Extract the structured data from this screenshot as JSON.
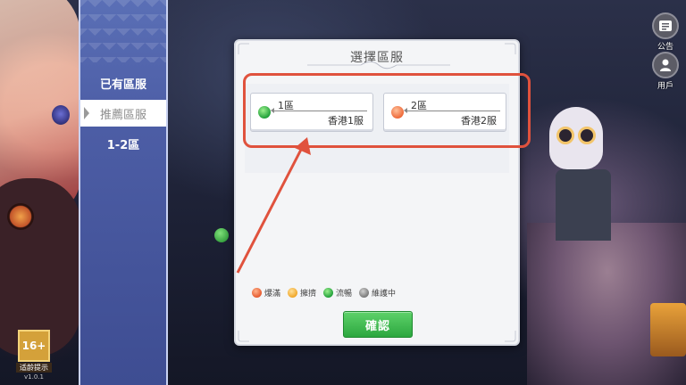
{
  "dialog": {
    "title": "選擇區服",
    "confirm_label": "確認",
    "servers": [
      {
        "zone": "1區",
        "name": "香港1服",
        "status_color": "#22a03a"
      },
      {
        "zone": "2區",
        "name": "香港2服",
        "status_color": "#ee6a3a"
      }
    ],
    "legend": [
      {
        "label": "爆滿",
        "icon": "status-full-dot"
      },
      {
        "label": "擁擠",
        "icon": "status-crowded-dot"
      },
      {
        "label": "流暢",
        "icon": "status-smooth-dot"
      },
      {
        "label": "維護中",
        "icon": "status-maintenance-dot"
      }
    ]
  },
  "sidebar": {
    "tabs": [
      {
        "label": "已有區服"
      },
      {
        "label": "推薦區服"
      },
      {
        "label": "1-2區"
      }
    ]
  },
  "top_right": {
    "notice_label": "公告",
    "user_label": "用戶"
  },
  "age_rating": {
    "rating": "16+",
    "caption": "适龄提示",
    "version": "v1.0.1"
  },
  "colors": {
    "accent_green": "#2ca73f",
    "annotation_red": "#e0523d",
    "sidebar_blue": "#4d5ea6"
  }
}
